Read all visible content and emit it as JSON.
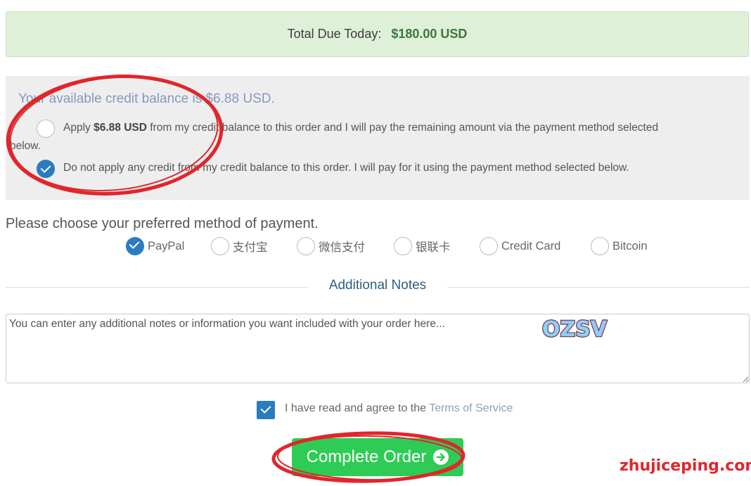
{
  "total_due": {
    "label": "Total Due Today:",
    "amount": "$180.00 USD"
  },
  "credit": {
    "title": "Your available credit balance is $6.88 USD.",
    "option_apply": {
      "prefix": "Apply ",
      "amount": "$6.88 USD",
      "line1_suffix": " from my credit balance to this order and I will pay the remaining amount via the payment method selected",
      "line2": "below.",
      "checked": false
    },
    "option_none": {
      "label": "Do not apply any credit from my credit balance to this order. I will pay for it using the payment method selected below.",
      "checked": true
    }
  },
  "payment": {
    "heading": "Please choose your preferred method of payment.",
    "methods": [
      {
        "label": "PayPal",
        "checked": true
      },
      {
        "label": "支付宝",
        "checked": false
      },
      {
        "label": "微信支付",
        "checked": false
      },
      {
        "label": "银联卡",
        "checked": false
      },
      {
        "label": "Credit Card",
        "checked": false
      },
      {
        "label": "Bitcoin",
        "checked": false
      }
    ]
  },
  "notes": {
    "title": "Additional Notes",
    "placeholder": "You can enter any additional notes or information you want included with your order here..."
  },
  "sticker": {
    "text": "OZSV"
  },
  "tos": {
    "checked": true,
    "text": "I have read and agree to the ",
    "link": "Terms of Service"
  },
  "submit": {
    "label": "Complete Order",
    "icon": "arrow-circle-right-icon"
  },
  "annotations": {
    "color": "#e0262b"
  },
  "watermark": {
    "text": "zhujiceping.com"
  },
  "colors": {
    "success_bg": "#dff0d8",
    "primary": "#2a7cc1",
    "button_green": "#2ecc55",
    "credit_title": "#8a95c2"
  }
}
